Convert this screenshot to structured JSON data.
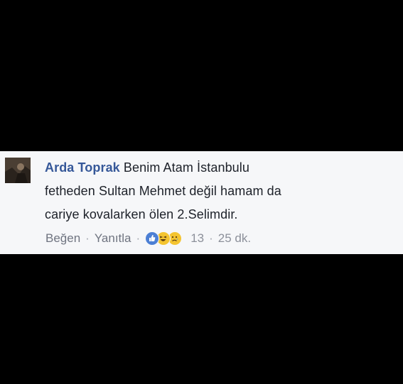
{
  "comment": {
    "author": "Arda Toprak",
    "text_line1": "Benim Atam İstanbulu",
    "text_line2": "fetheden Sultan Mehmet değil hamam da",
    "text_line3": "cariye kovalarken ölen 2.Selimdir.",
    "actions": {
      "like_label": "Beğen",
      "reply_label": "Yanıtla",
      "separator": "·",
      "reaction_count": "13",
      "time": "25 dk."
    },
    "reactions": [
      "like-icon",
      "haha-icon",
      "sad-icon"
    ]
  },
  "colors": {
    "background": "#000000",
    "card": "#f6f7f9",
    "author": "#365899",
    "text": "#1d2129",
    "meta": "#8c909a"
  }
}
